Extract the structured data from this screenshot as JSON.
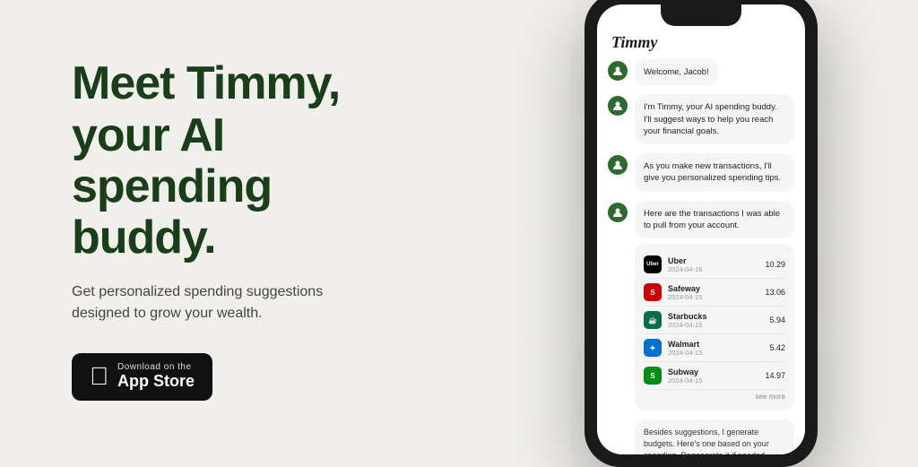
{
  "left": {
    "headline": "Meet Timmy, your AI spending buddy.",
    "subtitle": "Get personalized spending suggestions designed to grow your wealth.",
    "cta": {
      "small_text": "Download on the",
      "large_text": "App Store"
    }
  },
  "phone": {
    "app_title": "Timmy",
    "chat": {
      "messages": [
        {
          "text": "Welcome, Jacob!"
        },
        {
          "text": "I'm Timmy, your AI spending buddy. I'll suggest ways to help you reach your financial goals."
        },
        {
          "text": "As you make new transactions, I'll give you personalized spending tips."
        },
        {
          "text": "Here are the transactions I was able to pull from your account."
        }
      ],
      "transactions": [
        {
          "name": "Uber",
          "date": "2024-04-16",
          "amount": "10.29",
          "color": "#000000",
          "initial": "Uber"
        },
        {
          "name": "Safeway",
          "date": "2024-04-15",
          "amount": "13.06",
          "color": "#cc0000",
          "initial": "S"
        },
        {
          "name": "Starbucks",
          "date": "2024-04-15",
          "amount": "5.94",
          "color": "#00704a",
          "initial": "★"
        },
        {
          "name": "Walmart",
          "date": "2024-04-15",
          "amount": "5.42",
          "color": "#0071ce",
          "initial": "★"
        },
        {
          "name": "Subway",
          "date": "2024-04-15",
          "amount": "14.97",
          "color": "#008c15",
          "initial": "S"
        }
      ],
      "see_more": "see more",
      "bottom_message": "Besides suggestions, I generate budgets. Here's one based on your spending. Regenerate it if needed."
    }
  }
}
